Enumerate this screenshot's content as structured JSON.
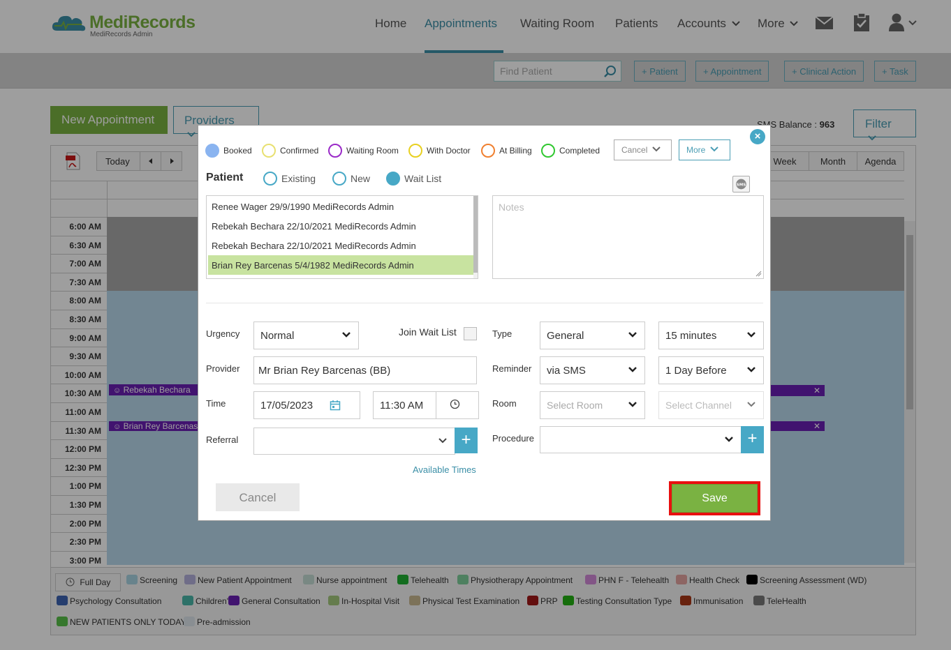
{
  "app": {
    "logo_brand": "MediRecords",
    "logo_subtitle": "MediRecords Admin"
  },
  "nav": {
    "items": [
      "Home",
      "Appointments",
      "Waiting Room",
      "Patients",
      "Accounts",
      "More"
    ],
    "active": "Appointments",
    "icons": [
      "envelope-icon",
      "clipboard-check-icon",
      "user-icon"
    ]
  },
  "toolbar": {
    "find_patient_placeholder": "Find Patient",
    "buttons": [
      "+ Patient",
      "+ Appointment",
      "+ Clinical Action",
      "+ Task"
    ]
  },
  "page": {
    "new_appointment": "New Appointment",
    "providers": "Providers",
    "sms_balance_label": "SMS Balance : ",
    "sms_balance_value": "963",
    "filter": "Filter"
  },
  "calendar": {
    "today": "Today",
    "views": [
      "Week",
      "Month",
      "Agenda"
    ],
    "times": [
      "6:00 AM",
      "6:30 AM",
      "7:00 AM",
      "7:30 AM",
      "8:00 AM",
      "8:30 AM",
      "9:00 AM",
      "9:30 AM",
      "10:00 AM",
      "10:30 AM",
      "11:00 AM",
      "11:30 AM",
      "12:00 PM",
      "12:30 PM",
      "1:00 PM",
      "1:30 PM",
      "2:00 PM",
      "2:30 PM",
      "3:00 PM"
    ],
    "appointments": [
      {
        "patient": "Rebekah Bechara",
        "time": "10:30 AM"
      },
      {
        "patient": "Brian Rey Barcenas",
        "time": "11:30 AM"
      }
    ]
  },
  "legend": {
    "full_day": "Full Day",
    "items": [
      {
        "label": "Screening",
        "color": "#a9d3e3"
      },
      {
        "label": "New Patient Appointment",
        "color": "#b4b0dc"
      },
      {
        "label": "Nurse appointment",
        "color": "#c4dcd4"
      },
      {
        "label": "Telehealth",
        "color": "#1fb032"
      },
      {
        "label": "Physiotherapy Appointment",
        "color": "#7fcf9b"
      },
      {
        "label": "PHN F - Telehealth",
        "color": "#d28ad8"
      },
      {
        "label": "Health Check",
        "color": "#e4a4a0"
      },
      {
        "label": "Screening Assessment (WD)",
        "color": "#000000"
      },
      {
        "label": "Psychology Consultation",
        "color": "#3d63b2"
      },
      {
        "label": "Children's",
        "color": "#4ab7a8"
      },
      {
        "label": "General Consultation",
        "color": "#6a1fb4"
      },
      {
        "label": "In-Hospital Visit",
        "color": "#a4c87c"
      },
      {
        "label": "Physical Test Examination",
        "color": "#c8b890"
      },
      {
        "label": "PRP",
        "color": "#a01818"
      },
      {
        "label": "Testing Consultation Type",
        "color": "#22b012"
      },
      {
        "label": "Immunisation",
        "color": "#a83818"
      },
      {
        "label": "TeleHealth",
        "color": "#787878"
      },
      {
        "label": "NEW PATIENTS ONLY TODAY",
        "color": "#58c04a"
      },
      {
        "label": "Pre-admission",
        "color": "#dde6ec"
      }
    ]
  },
  "modal": {
    "statuses": [
      {
        "label": "Booked",
        "color": "#8ab4f0",
        "filled": true
      },
      {
        "label": "Confirmed",
        "color": "#e8e070",
        "filled": false
      },
      {
        "label": "Waiting Room",
        "color": "#9a2ac8",
        "filled": false
      },
      {
        "label": "With Doctor",
        "color": "#e8d020",
        "filled": false
      },
      {
        "label": "At Billing",
        "color": "#f08030",
        "filled": false
      },
      {
        "label": "Completed",
        "color": "#30c830",
        "filled": false
      }
    ],
    "cancel_select": "Cancel",
    "more_select": "More",
    "patient_label": "Patient",
    "patient_modes": [
      {
        "label": "Existing",
        "selected": false
      },
      {
        "label": "New",
        "selected": false
      },
      {
        "label": "Wait List",
        "selected": true
      }
    ],
    "patient_list": [
      "Renee Wager 29/9/1990 MediRecords Admin",
      "Rebekah Bechara 22/10/2021 MediRecords Admin",
      "Rebekah Bechara 22/10/2021 MediRecords Admin",
      "Brian Rey Barcenas 5/4/1982 MediRecords Admin"
    ],
    "selected_patient_index": 3,
    "notes_placeholder": "Notes",
    "labels": {
      "urgency": "Urgency",
      "join_wait_list": "Join Wait List",
      "type": "Type",
      "provider": "Provider",
      "reminder": "Reminder",
      "time": "Time",
      "room": "Room",
      "referral": "Referral",
      "procedure": "Procedure"
    },
    "values": {
      "urgency": "Normal",
      "type": "General",
      "duration": "15 minutes",
      "provider": "Mr Brian Rey Barcenas (BB)",
      "reminder": "via SMS",
      "reminder_time": "1 Day Before",
      "date": "17/05/2023",
      "time": "11:30 AM",
      "room_placeholder": "Select Room",
      "channel_placeholder": "Select Channel",
      "referral": "",
      "procedure": ""
    },
    "available_times": "Available Times",
    "cancel_button": "Cancel",
    "save_button": "Save"
  }
}
